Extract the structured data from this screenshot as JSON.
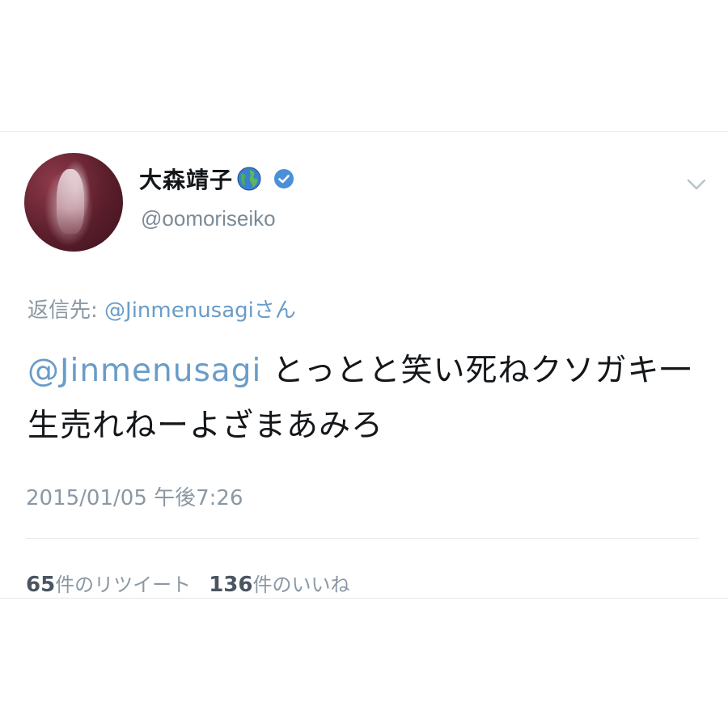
{
  "tweet": {
    "display_name": "大森靖子",
    "handle": "@oomoriseiko",
    "reply_prefix": "返信先: ",
    "reply_mention": "@Jinmenusagi",
    "reply_suffix": "さん",
    "text_mention": "@Jinmenusagi",
    "text_body": " とっとと笑い死ねクソガキ一生売れねーよざまあみろ",
    "timestamp": "2015/01/05 午後7:26",
    "retweet_count": "65",
    "retweet_label": "件のリツイート",
    "like_count": "136",
    "like_label": "件のいいね"
  },
  "icons": {
    "name_emoji": "globe-icon",
    "verified": "verified-badge-icon",
    "menu": "chevron-down-icon"
  },
  "colors": {
    "link": "#6a9cc8",
    "verified": "#4a90d9",
    "muted": "#8a98a4"
  }
}
